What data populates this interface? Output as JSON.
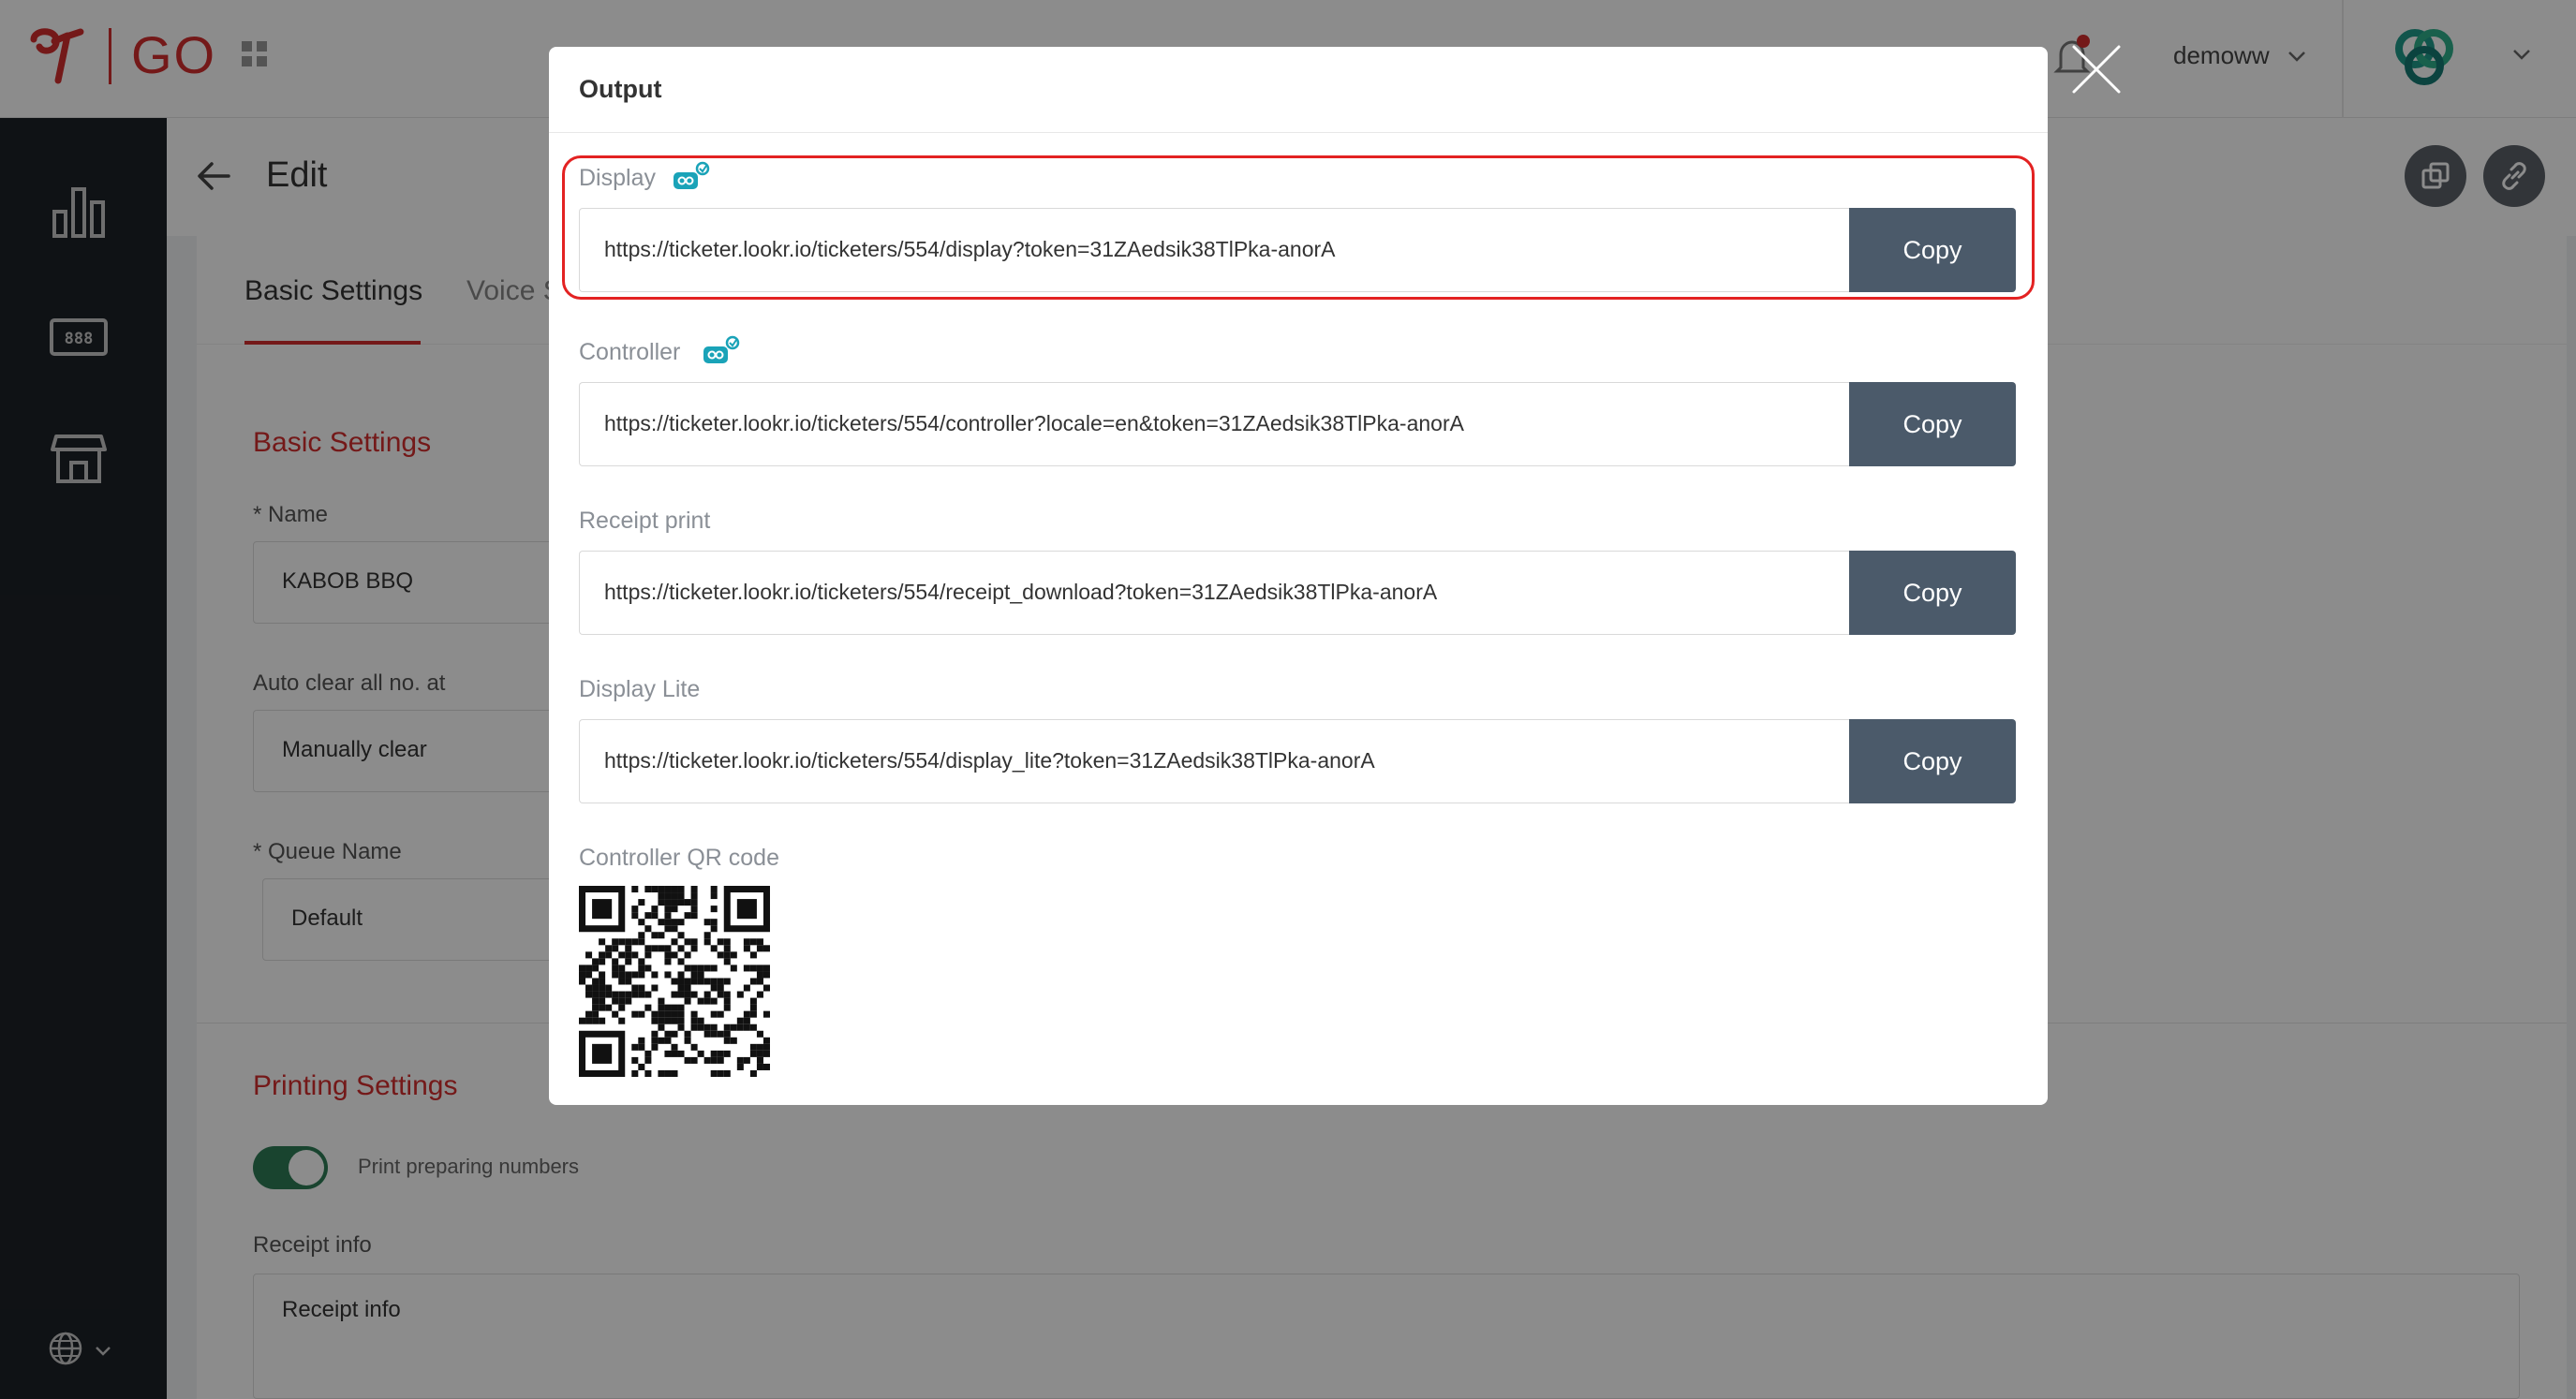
{
  "header": {
    "logo_text": "GO",
    "user_name": "demoww"
  },
  "page": {
    "title": "Edit",
    "tabs": [
      {
        "label": "Basic Settings"
      },
      {
        "label": "Voice S"
      }
    ]
  },
  "form": {
    "basic_settings_title": "Basic Settings",
    "name_label": "* Name",
    "name_value": "KABOB BBQ",
    "auto_clear_label": "Auto clear all no. at",
    "auto_clear_value": "Manually clear",
    "queue_name_label": "* Queue Name",
    "queue_name_value": "Default",
    "printing_title": "Printing Settings",
    "print_toggle_label": "Print preparing numbers",
    "receipt_info_label": "Receipt info",
    "receipt_info_placeholder": "Receipt info"
  },
  "modal": {
    "title": "Output",
    "items": [
      {
        "label": "Display",
        "url": "https://ticketer.lookr.io/ticketers/554/display?token=31ZAedsik38TlPka-anorA",
        "button": "Copy"
      },
      {
        "label": "Controller",
        "url": "https://ticketer.lookr.io/ticketers/554/controller?locale=en&token=31ZAedsik38TlPka-anorA",
        "button": "Copy"
      },
      {
        "label": "Receipt print",
        "url": "https://ticketer.lookr.io/ticketers/554/receipt_download?token=31ZAedsik38TlPka-anorA",
        "button": "Copy"
      },
      {
        "label": "Display Lite",
        "url": "https://ticketer.lookr.io/ticketers/554/display_lite?token=31ZAedsik38TlPka-anorA",
        "button": "Copy"
      }
    ],
    "qr_label": "Controller QR code"
  },
  "colors": {
    "brand_red": "#d32f2f",
    "sidebar_bg": "#1d2127",
    "copy_button": "#4b5a6a",
    "highlight": "#e32222",
    "toggle_on": "#2e7d57",
    "link_icon": "#1aa3b8"
  },
  "icons": [
    "logo-mark-icon",
    "apps-grid-icon",
    "bell-icon",
    "close-icon",
    "chevron-down-icon",
    "brand-rings-icon",
    "bar-chart-icon",
    "display-888-icon",
    "store-icon",
    "globe-icon",
    "arrow-left-icon",
    "duplicate-icon",
    "link-icon",
    "external-link-icon"
  ]
}
